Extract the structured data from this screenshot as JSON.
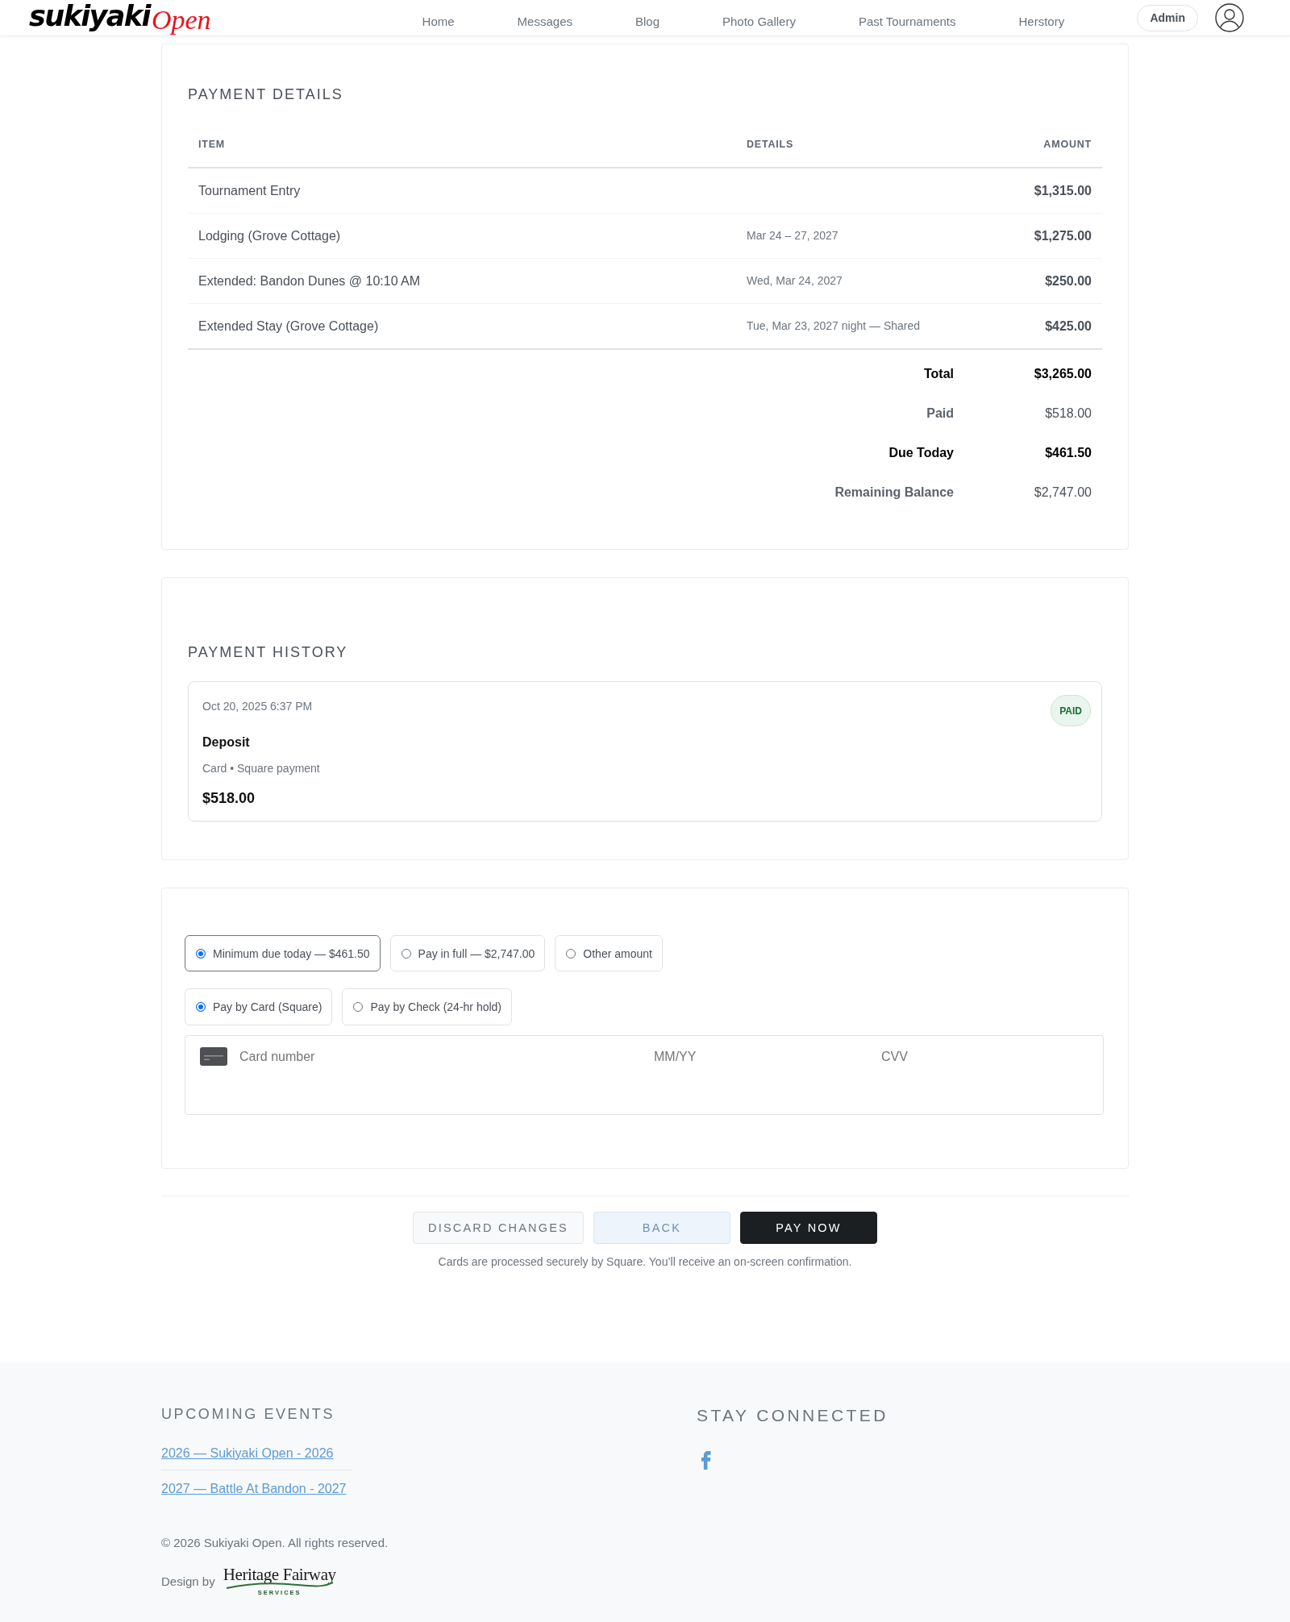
{
  "header": {
    "logo": {
      "wordmark": "sukiyaki",
      "script": "Open"
    },
    "nav": [
      {
        "label": "Home"
      },
      {
        "label": "Messages"
      },
      {
        "label": "Blog"
      },
      {
        "label": "Photo Gallery"
      },
      {
        "label": "Past Tournaments"
      },
      {
        "label": "Herstory"
      }
    ],
    "admin_button": "Admin"
  },
  "payment_details": {
    "title": "PAYMENT DETAILS",
    "columns": [
      "ITEM",
      "DETAILS",
      "AMOUNT"
    ],
    "rows": [
      {
        "item": "Tournament Entry",
        "amount": "$1,315.00"
      },
      {
        "item": "Lodging (Grove Cottage)",
        "details": "Mar 24 – 27, 2027",
        "amount": "$1,275.00"
      },
      {
        "item": "Extended: Bandon Dunes @ 10:10 AM",
        "details": "Wed, Mar 24, 2027",
        "amount": "$250.00"
      },
      {
        "item": "Extended Stay (Grove Cottage)",
        "details": "Tue, Mar 23, 2027 night — Shared",
        "amount": "$425.00"
      }
    ],
    "totals": [
      {
        "label": "Total",
        "amount": "$3,265.00",
        "strong": true
      },
      {
        "label": "Paid",
        "amount": "$518.00",
        "strong": false
      },
      {
        "label": "Due Today",
        "amount": "$461.50",
        "strong": true
      },
      {
        "label": "Remaining Balance",
        "amount": "$2,747.00",
        "strong": false
      }
    ]
  },
  "payment_history": {
    "title": "PAYMENT HISTORY",
    "entries": [
      {
        "date": "Oct 20, 2025 6:37 PM",
        "status": "PAID",
        "title": "Deposit",
        "meta": "Card • Square payment",
        "amount": "$518.00"
      }
    ]
  },
  "payment": {
    "amount_options": [
      {
        "label": "Minimum due today — $461.50",
        "selected": true,
        "focused": true
      },
      {
        "label": "Pay in full — $2,747.00",
        "selected": false,
        "focused": false
      },
      {
        "label": "Other amount",
        "selected": false,
        "focused": false
      }
    ],
    "method_options": [
      {
        "label": "Pay by Card (Square)",
        "selected": true,
        "focused": false
      },
      {
        "label": "Pay by Check (24-hr hold)",
        "selected": false,
        "focused": false
      }
    ],
    "card_form": {
      "card_number": {
        "placeholder": "Card number"
      },
      "expiry": {
        "placeholder": "MM/YY"
      },
      "cvv": {
        "placeholder": "CVV"
      }
    }
  },
  "actions": {
    "buttons": [
      {
        "label": "DISCARD CHANGES",
        "kind": "secondary"
      },
      {
        "label": "BACK",
        "kind": "light"
      },
      {
        "label": "PAY NOW",
        "kind": "primary"
      }
    ],
    "note": "Cards are processed securely by Square. You’ll receive an on-screen confirmation."
  },
  "footer": {
    "events_title": "UPCOMING EVENTS",
    "events": [
      {
        "label": "2026 — Sukiyaki Open - 2026"
      },
      {
        "label": "2027 — Battle At Bandon - 2027"
      }
    ],
    "social_title": "STAY CONNECTED",
    "copyright": "© 2026 Sukiyaki Open. All rights reserved.",
    "credit": {
      "label": "Design by",
      "logo_name": "Heritage Fairway",
      "logo_tagline": "SERVICES"
    }
  }
}
